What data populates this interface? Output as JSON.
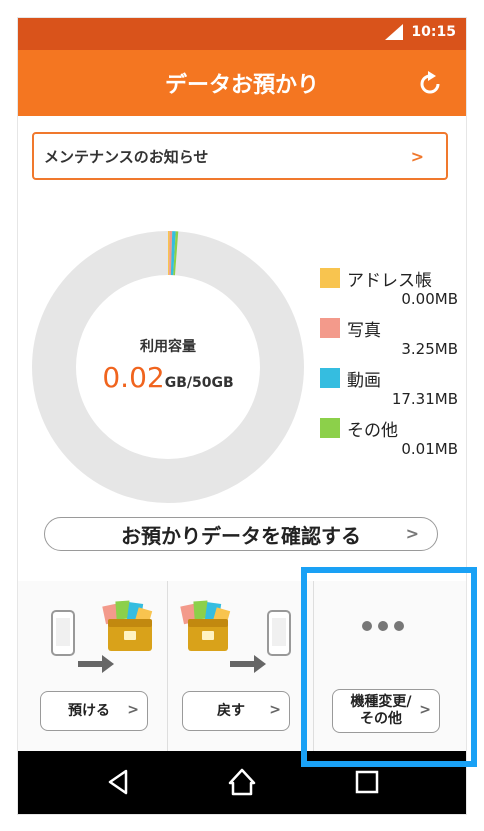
{
  "status_bar": {
    "time": "10:15"
  },
  "header": {
    "title": "データお預かり"
  },
  "notice": {
    "label": "メンテナンスのお知らせ"
  },
  "usage": {
    "center_label": "利用容量",
    "used_value": "0.02",
    "used_unit": "GB/50GB"
  },
  "chart_data": {
    "type": "pie",
    "total_gb": 50,
    "used_gb": 0.02,
    "series": [
      {
        "name": "アドレス帳",
        "value_mb": 0.0,
        "label": "0.00MB",
        "color": "#f8c44f"
      },
      {
        "name": "写真",
        "value_mb": 3.25,
        "label": "3.25MB",
        "color": "#f39a8b"
      },
      {
        "name": "動画",
        "value_mb": 17.31,
        "label": "17.31MB",
        "color": "#35bde0"
      },
      {
        "name": "その他",
        "value_mb": 0.01,
        "label": "0.01MB",
        "color": "#8cd04a"
      }
    ],
    "remaining_color": "#e6e6e6"
  },
  "confirm_button": {
    "label": "お預かりデータを確認する"
  },
  "actions": [
    {
      "label": "預ける"
    },
    {
      "label": "戻す"
    },
    {
      "label_line1": "機種変更/",
      "label_line2": "その他"
    }
  ],
  "colors": {
    "status_bar": "#d9531b",
    "app_bar": "#f47621",
    "accent": "#f0641e",
    "highlight": "#1aa1f5"
  },
  "icons": {
    "refresh": "refresh-icon",
    "signal": "signal-icon",
    "back": "back-icon",
    "home": "home-icon",
    "recents": "recents-icon"
  }
}
